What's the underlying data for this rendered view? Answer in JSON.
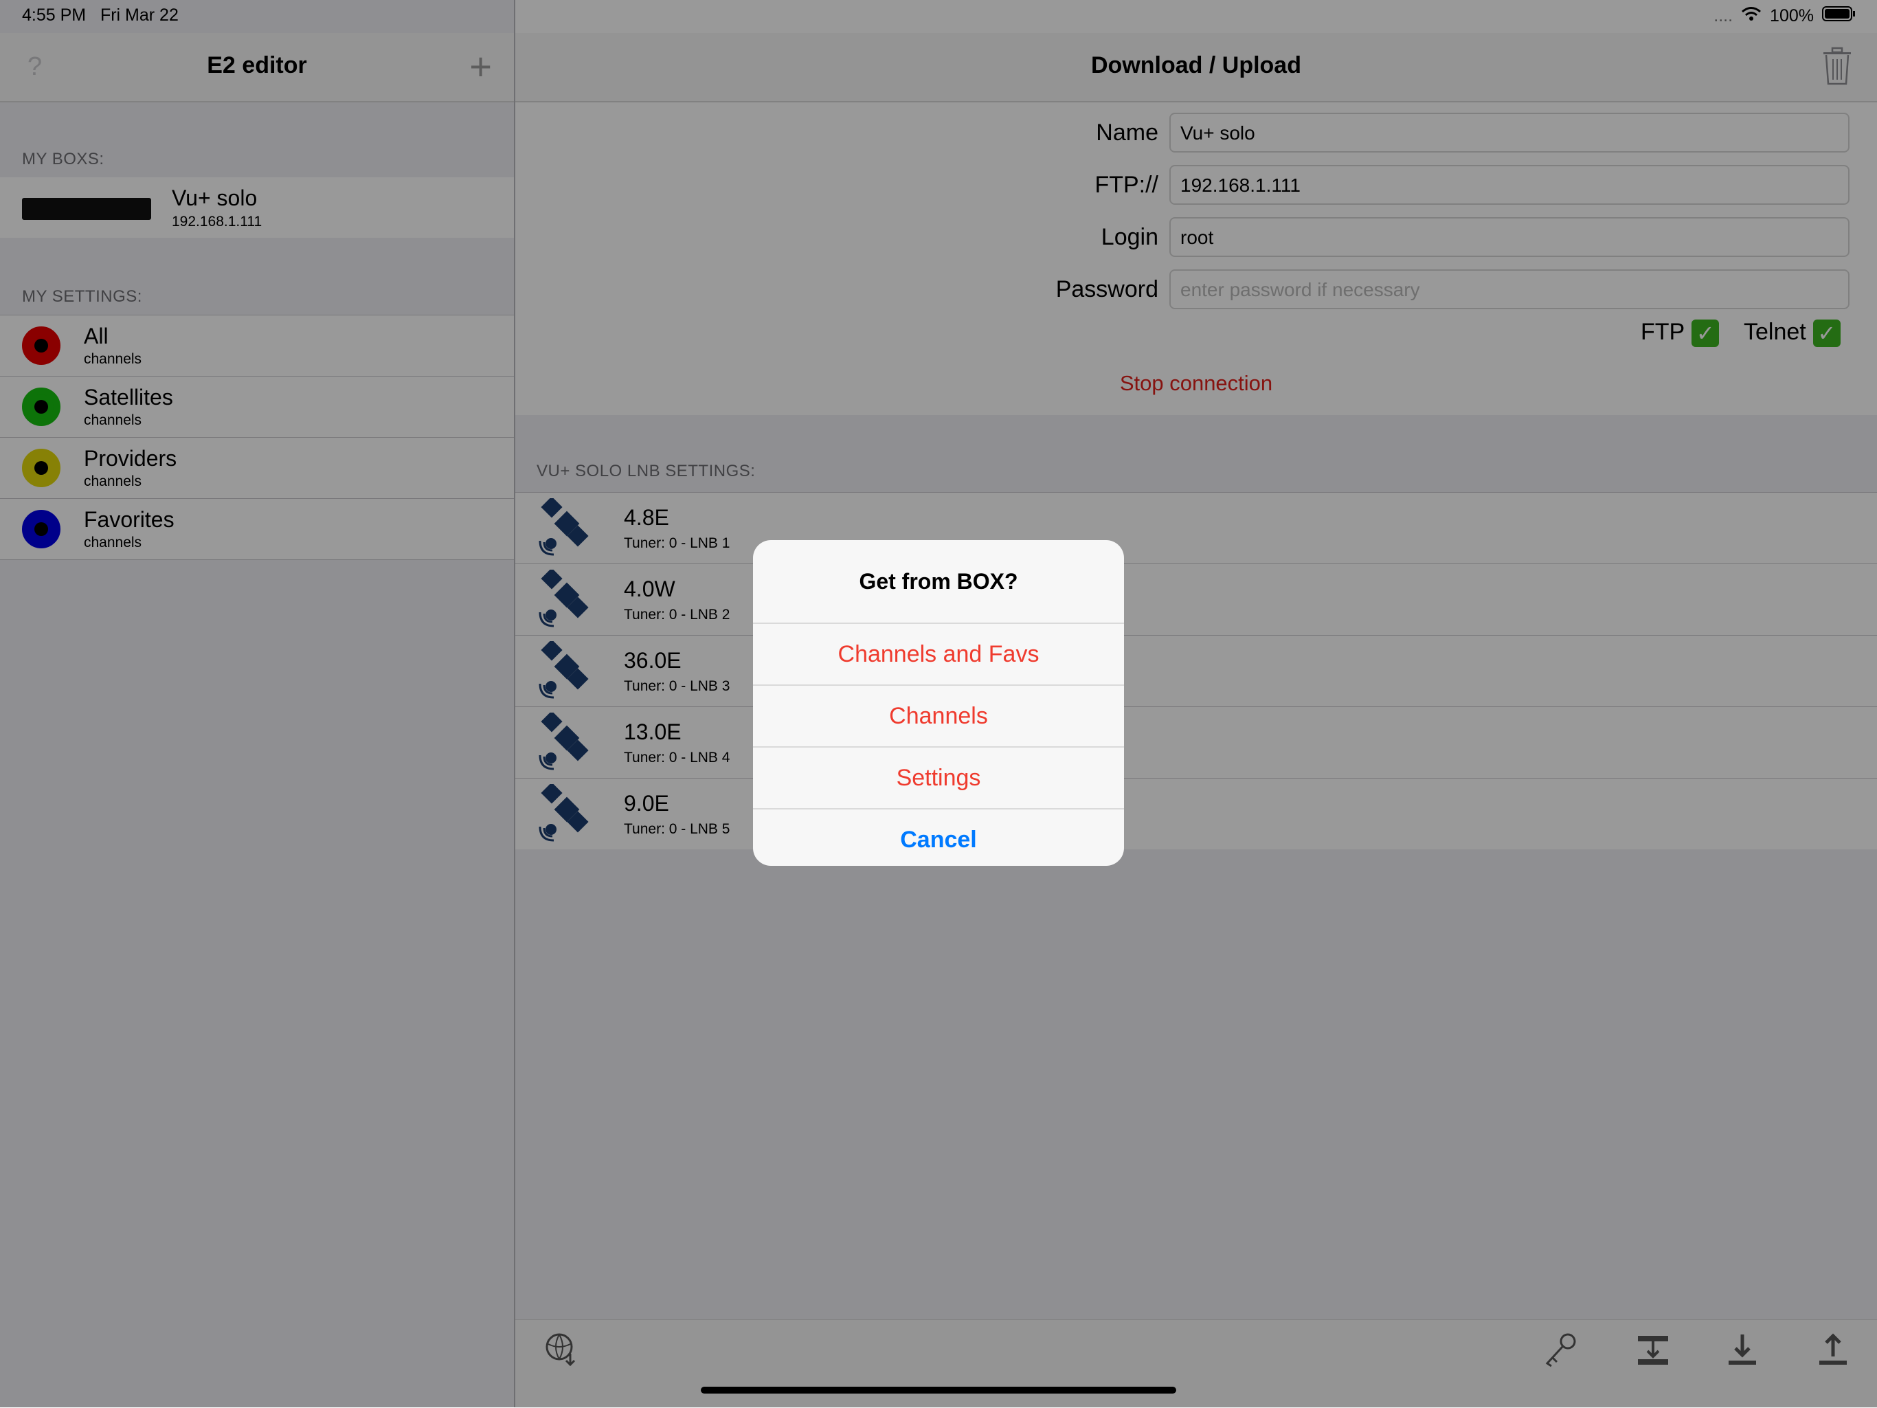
{
  "status_bar": {
    "time": "4:55 PM",
    "date": "Fri Mar 22",
    "signal": "....",
    "battery": "100%"
  },
  "master": {
    "nav_title": "E2 editor",
    "help_glyph": "?",
    "add_glyph": "+",
    "boxes_header": "MY BOXS:",
    "box": {
      "name": "Vu+ solo",
      "ip": "192.168.1.111"
    },
    "settings_header": "MY SETTINGS:",
    "settings": [
      {
        "label": "All",
        "sub": "channels",
        "color": "#e60000"
      },
      {
        "label": "Satellites",
        "sub": "channels",
        "color": "#16c00f"
      },
      {
        "label": "Providers",
        "sub": "channels",
        "color": "#e2d80b"
      },
      {
        "label": "Favorites",
        "sub": "channels",
        "color": "#0000e6"
      }
    ]
  },
  "detail": {
    "nav_title": "Download / Upload",
    "form": {
      "name_label": "Name",
      "name_value": "Vu+ solo",
      "ftp_label": "FTP://",
      "ftp_value": "192.168.1.111",
      "login_label": "Login",
      "login_value": "root",
      "password_label": "Password",
      "password_placeholder": "enter password if necessary",
      "ftp_status_label": "FTP",
      "telnet_status_label": "Telnet",
      "check_glyph": "✓"
    },
    "stop_connection": "Stop connection",
    "lnb_header": "VU+ SOLO LNB SETTINGS:",
    "lnb": [
      {
        "pos": "4.8E",
        "info": "Tuner: 0 - LNB 1"
      },
      {
        "pos": "4.0W",
        "info": "Tuner: 0 - LNB 2"
      },
      {
        "pos": "36.0E",
        "info": "Tuner: 0 - LNB 3"
      },
      {
        "pos": "13.0E",
        "info": "Tuner: 0 - LNB 4"
      },
      {
        "pos": "9.0E",
        "info": "Tuner: 0 - LNB 5"
      }
    ]
  },
  "alert": {
    "title": "Get from BOX?",
    "options": [
      "Channels and Favs",
      "Channels",
      "Settings"
    ],
    "cancel": "Cancel"
  },
  "colors": {
    "accent_red": "#ef3b2e",
    "accent_blue": "#007aff",
    "check_green": "#3cb521",
    "satellite_blue": "#1c3d6e"
  }
}
